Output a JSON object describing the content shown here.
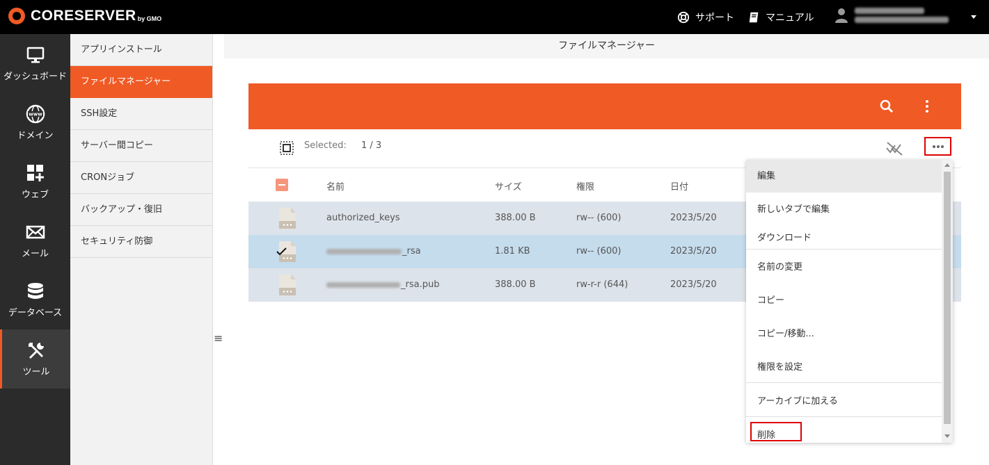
{
  "header": {
    "logo_text": "CORESERVER",
    "logo_sub": "by GMO",
    "support_label": "サポート",
    "manual_label": "マニュアル"
  },
  "leftnav": {
    "items": [
      {
        "label": "ダッシュボード",
        "icon": "monitor-icon"
      },
      {
        "label": "ドメイン",
        "icon": "www-globe-icon"
      },
      {
        "label": "ウェブ",
        "icon": "web-grid-icon"
      },
      {
        "label": "メール",
        "icon": "mail-icon"
      },
      {
        "label": "データベース",
        "icon": "database-icon"
      },
      {
        "label": "ツール",
        "icon": "tools-icon"
      }
    ],
    "active": "ツール"
  },
  "subnav": {
    "items": [
      "アプリインストール",
      "ファイルマネージャー",
      "SSH設定",
      "サーバー間コピー",
      "CRONジョブ",
      "バックアップ・復旧",
      "セキュリティ防御"
    ],
    "active": "ファイルマネージャー"
  },
  "main": {
    "title": "ファイルマネージャー",
    "selected_label": "Selected:",
    "selected_count": "1 / 3",
    "columns": {
      "name": "名前",
      "size": "サイズ",
      "perm": "権限",
      "date": "日付"
    },
    "rows": [
      {
        "name": "authorized_keys",
        "size": "388.00 B",
        "perm": "rw-- (600)",
        "date": "2023/5/20",
        "checked": false
      },
      {
        "name_suffix": "_rsa",
        "size": "1.81 KB",
        "perm": "rw-- (600)",
        "date": "2023/5/20",
        "checked": true
      },
      {
        "name_suffix": "_rsa.pub",
        "size": "388.00 B",
        "perm": "rw-r-r (644)",
        "date": "2023/5/20",
        "checked": false
      }
    ]
  },
  "context_menu": {
    "items": [
      "編集",
      "新しいタブで編集",
      "ダウンロード",
      "名前の変更",
      "コピー",
      "コピー/移動...",
      "権限を設定",
      "アーカイブに加える",
      "削除"
    ]
  },
  "colors": {
    "accent": "#f05a24",
    "topbar": "#000000",
    "leftnav": "#2b2b2b",
    "highlight": "#e00000",
    "selected_row": "#c5dced",
    "row": "#dde3ea"
  }
}
